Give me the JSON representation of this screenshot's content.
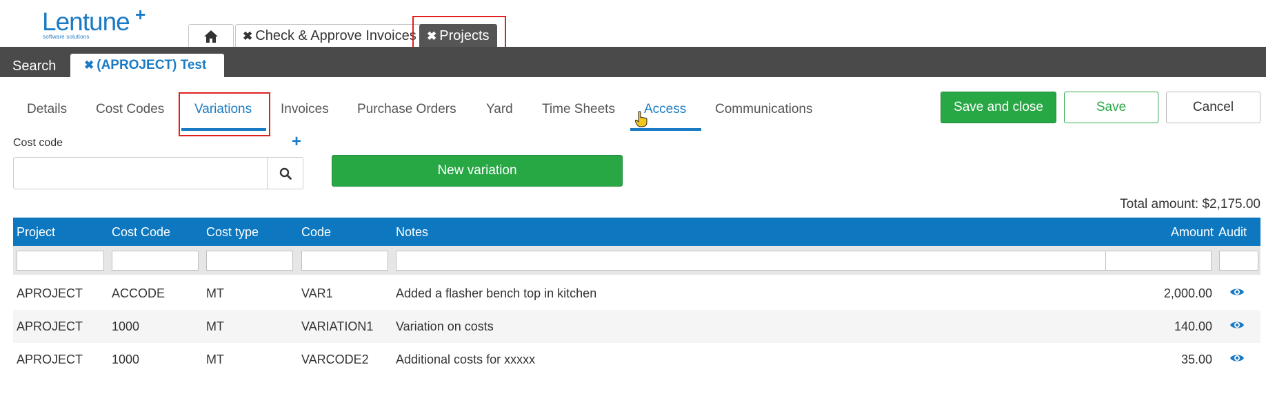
{
  "logo": {
    "name": "Lentune",
    "plus": "+",
    "tagline": "software solutions"
  },
  "top_tabs": [
    {
      "icon": "home-icon"
    },
    {
      "label": "Check & Approve Invoices",
      "close": "✖"
    },
    {
      "label": "Projects",
      "close": "✖",
      "active": true
    }
  ],
  "dark_bar": {
    "search_label": "Search",
    "project_tab": {
      "close": "✖",
      "label": "(APROJECT) Test"
    }
  },
  "sub_tabs": [
    "Details",
    "Cost Codes",
    "Variations",
    "Invoices",
    "Purchase Orders",
    "Yard",
    "Time Sheets",
    "Access",
    "Communications"
  ],
  "active_sub_tab": "Variations",
  "actions": {
    "save_close": "Save and close",
    "save": "Save",
    "cancel": "Cancel"
  },
  "cost_code": {
    "label": "Cost code",
    "add": "+",
    "value": ""
  },
  "new_variation": "New variation",
  "total_amount": "Total amount: $2,175.00",
  "table": {
    "headers": [
      "Project",
      "Cost Code",
      "Cost type",
      "Code",
      "Notes",
      "Amount",
      "Audit"
    ],
    "rows": [
      {
        "project": "APROJECT",
        "cost_code": "ACCODE",
        "cost_type": "MT",
        "code": "VAR1",
        "notes": "Added a flasher bench top in kitchen",
        "amount": "2,000.00"
      },
      {
        "project": "APROJECT",
        "cost_code": "1000",
        "cost_type": "MT",
        "code": "VARIATION1",
        "notes": "Variation on costs",
        "amount": "140.00"
      },
      {
        "project": "APROJECT",
        "cost_code": "1000",
        "cost_type": "MT",
        "code": "VARCODE2",
        "notes": "Additional costs for xxxxx",
        "amount": "35.00"
      }
    ]
  },
  "colors": {
    "accent": "#1a7bc4",
    "header_blue": "#0d77c0",
    "green": "#28a745",
    "dark_bar": "#4a4a4a",
    "highlight": "#e02020"
  }
}
